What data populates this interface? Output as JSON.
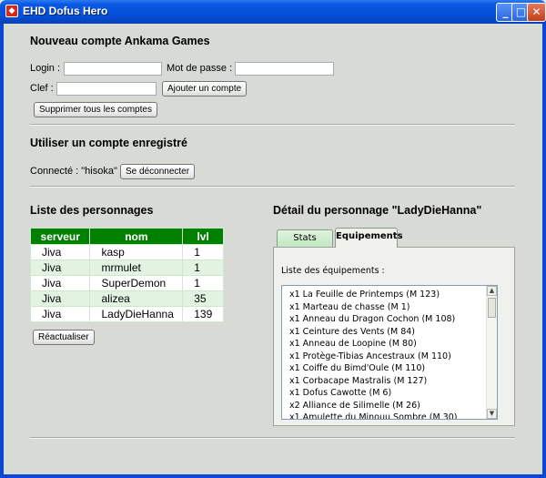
{
  "window": {
    "title": "EHD Dofus Hero",
    "icon": "dofus-app-icon",
    "controls": {
      "minimize": "_",
      "maximize": "□",
      "close": "✕"
    }
  },
  "new_account": {
    "title": "Nouveau compte Ankama Games",
    "login_label": "Login :",
    "login_value": "",
    "password_label": "Mot de passe :",
    "password_value": "",
    "key_label": "Clef :",
    "key_value": "",
    "add_button": "Ajouter un compte",
    "delete_all_button": "Supprimer tous les comptes"
  },
  "saved_account": {
    "title": "Utiliser un compte enregistré",
    "connected_text": "Connecté : \"hisoka\"",
    "disconnect_button": "Se déconnecter"
  },
  "characters": {
    "title": "Liste des personnages",
    "columns": [
      "serveur",
      "nom",
      "lvl"
    ],
    "rows": [
      [
        "Jiva",
        "kasp",
        "1"
      ],
      [
        "Jiva",
        "mrmulet",
        "1"
      ],
      [
        "Jiva",
        "SuperDemon",
        "1"
      ],
      [
        "Jiva",
        "alizea",
        "35"
      ],
      [
        "Jiva",
        "LadyDieHanna",
        "139"
      ]
    ],
    "refresh_button": "Réactualiser"
  },
  "detail": {
    "title": "Détail du personnage \"LadyDieHanna\"",
    "tabs": [
      "Stats",
      "Equipements"
    ],
    "active_tab": "Equipements",
    "equipment_label": "Liste des équipements :",
    "equipment": [
      "x1 La Feuille de Printemps (M 123)",
      "x1 Marteau de chasse (M 1)",
      "x1 Anneau du Dragon Cochon (M 108)",
      "x1 Ceinture des Vents (M 84)",
      "x1 Anneau de Loopine (M 80)",
      "x1 Protège-Tibias Ancestraux (M 110)",
      "x1 Coiffe du Bimd'Oule (M 110)",
      "x1 Corbacape Mastralis (M 127)",
      "x1 Dofus Cawotte (M 6)",
      "x2 Alliance de Silimelle (M 26)",
      "x1 Amulette du Minouu Sombre (M 30)"
    ]
  }
}
